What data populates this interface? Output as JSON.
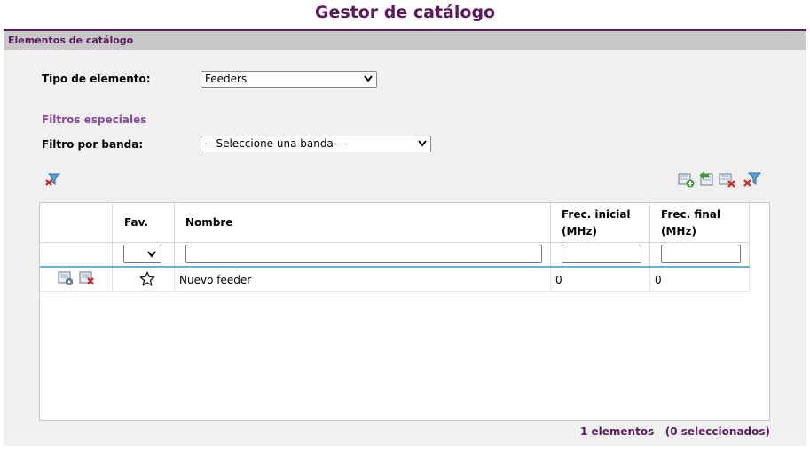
{
  "page": {
    "title": "Gestor de catálogo"
  },
  "panel": {
    "header": "Elementos de catálogo"
  },
  "form": {
    "tipo_label": "Tipo de elemento:",
    "tipo_value": "Feeders",
    "special_filters": "Filtros especiales",
    "banda_label": "Filtro por banda:",
    "banda_value": "-- Seleccione una banda --"
  },
  "grid": {
    "columns": {
      "fav": "Fav.",
      "nombre": "Nombre",
      "frec_inicial_1": "Frec. inicial",
      "frec_inicial_2": "(MHz)",
      "frec_final_1": "Frec. final",
      "frec_final_2": "(MHz)"
    },
    "rows": [
      {
        "nombre": "Nuevo feeder",
        "frec_inicial": "0",
        "frec_final": "0"
      }
    ]
  },
  "footer": {
    "count": "1 elementos",
    "selected": "(0 seleccionados)"
  },
  "colors": {
    "brand": "#5a1a5e",
    "header_bg": "#c8c8c8",
    "panel_bg": "#f0f0f0",
    "accent_line": "#6aaede"
  },
  "icons": [
    "clear-filter-icon",
    "add-icon",
    "import-icon",
    "delete-icon",
    "delete-filter-icon",
    "edit-icon",
    "delete-row-icon",
    "star-icon"
  ]
}
